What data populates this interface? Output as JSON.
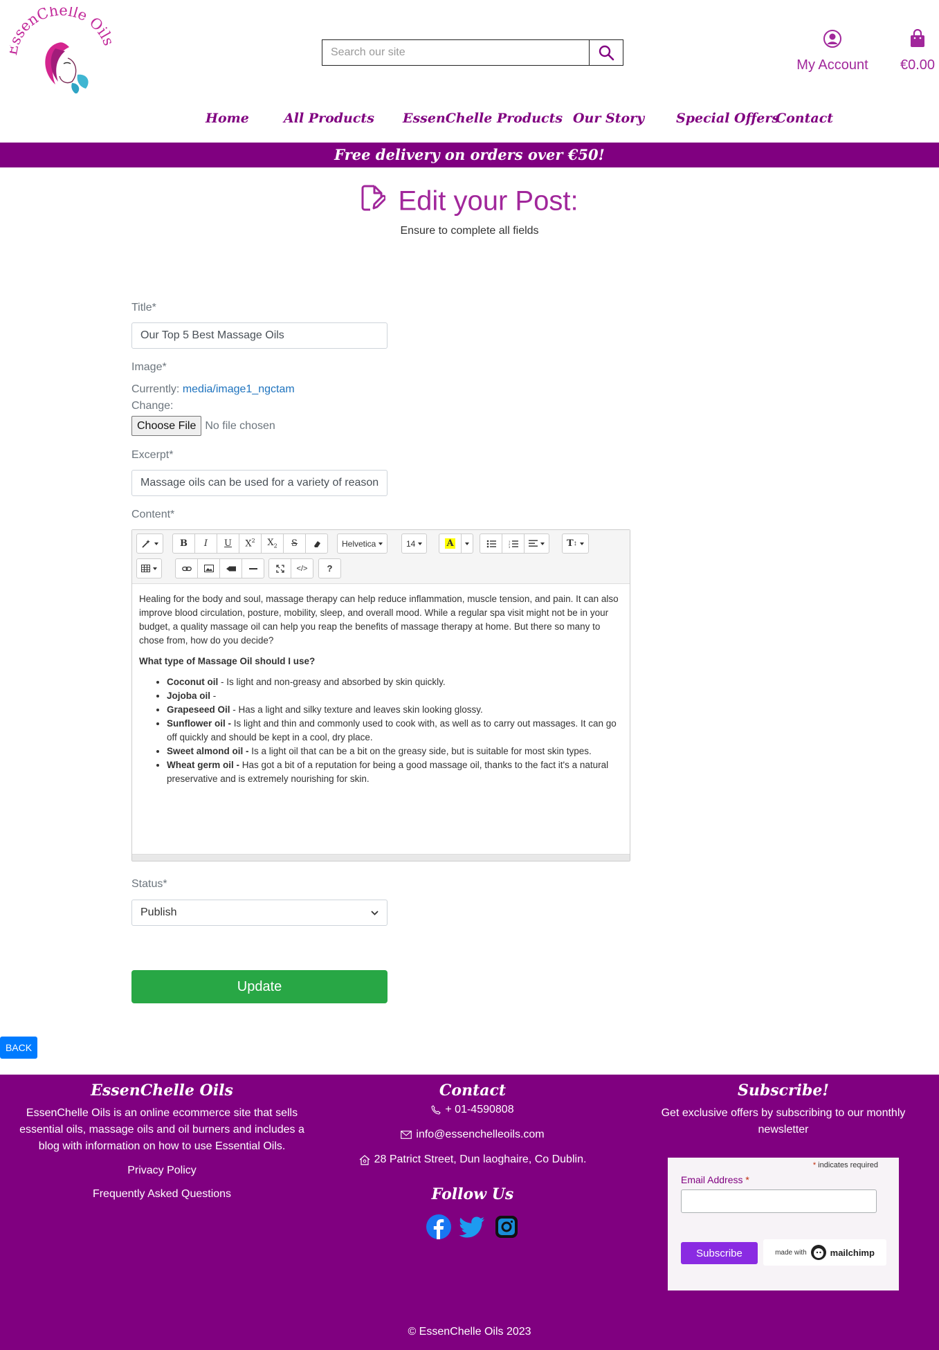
{
  "brand": {
    "name": "EssenChelle Oils"
  },
  "search": {
    "placeholder": "Search our site"
  },
  "header": {
    "account_label": "My Account",
    "cart_total": "€0.00"
  },
  "nav": {
    "items": [
      "Home",
      "All Products",
      "EssenChelle Products",
      "Our Story",
      "Special Offers",
      "Contact"
    ]
  },
  "banner": {
    "text": "Free delivery on orders over €50!"
  },
  "page": {
    "title": "Edit your Post:",
    "subtitle": "Ensure to complete all fields"
  },
  "form": {
    "title_label": "Title*",
    "title_value": "Our Top 5 Best Massage Oils",
    "image_label": "Image*",
    "currently_label": "Currently:",
    "currently_link": "media/image1_ngctam",
    "change_label": "Change:",
    "choose_file": "Choose File",
    "no_file": "No file chosen",
    "excerpt_label": "Excerpt*",
    "excerpt_value": "Massage oils can be used for a variety of reason",
    "content_label": "Content*",
    "status_label": "Status*",
    "status_value": "Publish",
    "submit_label": "Update"
  },
  "editor": {
    "font_name": "Helvetica",
    "font_size": "14",
    "intro": "Healing for the body and soul, massage therapy can help reduce inflammation, muscle tension, and pain. It can also improve blood circulation, posture, mobility, sleep, and overall mood. While a regular spa visit might not be in your budget, a quality massage oil can help you reap the benefits of massage therapy at home. But there so many to chose from, how do you decide?",
    "heading": "What type of Massage Oil should I use?",
    "items": [
      {
        "name": "Coconut oil",
        "text": " - Is light and non-greasy and absorbed by skin quickly."
      },
      {
        "name": "Jojoba oil",
        "text": " - "
      },
      {
        "name": "Grapeseed Oil",
        "text": " - Has a light and silky texture and leaves skin looking glossy."
      },
      {
        "name": "Sunflower oil -",
        "text": " Is light and thin and commonly used to cook with, as well as to carry out massages. It can go off quickly and should be kept in a cool, dry place."
      },
      {
        "name": "Sweet almond oil -",
        "text": " Is a light oil that can be a bit on the greasy side, but is suitable for most skin types."
      },
      {
        "name": "Wheat germ oil -",
        "text": " Has got a bit of a reputation for being a good massage oil, thanks to the fact it's a natural preservative and is extremely nourishing for skin."
      }
    ]
  },
  "back_label": "BACK",
  "footer": {
    "about_heading": "EssenChelle Oils",
    "about_text": "EssenChelle Oils is an online ecommerce site that sells essential oils, massage oils and oil burners and includes a blog with information on how to use Essential Oils.",
    "privacy": "Privacy Policy",
    "faq": "Frequently Asked Questions",
    "contact_heading": "Contact",
    "phone": "+ 01-4590808",
    "email": "info@essenchelleoils.com",
    "address": "28 Patrict Street, Dun laoghaire, Co Dublin.",
    "follow_heading": "Follow Us",
    "subscribe_heading": "Subscribe!",
    "subscribe_text": "Get exclusive offers by subscribing to our monthly newsletter",
    "indicates_required": "indicates required",
    "email_label": "Email Address",
    "subscribe_button": "Subscribe",
    "made_with": "made with",
    "mailchimp": "mailchimp",
    "copyright": "© EssenChelle Oils 2023"
  },
  "colors": {
    "brand": "#800080",
    "accent": "#a1279b",
    "success": "#28a745",
    "primary": "#007bff"
  }
}
